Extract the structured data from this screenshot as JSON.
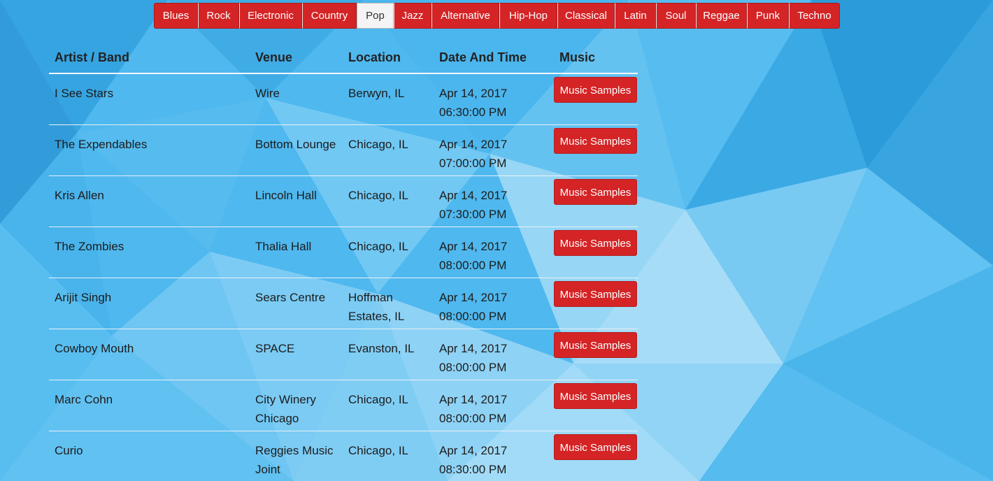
{
  "colors": {
    "accent_red": "#d42426",
    "background_blue": "#4fb8ee",
    "active_tab_bg": "#f4f4f4"
  },
  "genres": [
    {
      "label": "Blues",
      "active": false
    },
    {
      "label": "Rock",
      "active": false
    },
    {
      "label": "Electronic",
      "active": false
    },
    {
      "label": "Country",
      "active": false
    },
    {
      "label": "Pop",
      "active": true
    },
    {
      "label": "Jazz",
      "active": false
    },
    {
      "label": "Alternative",
      "active": false
    },
    {
      "label": "Hip-Hop",
      "active": false
    },
    {
      "label": "Classical",
      "active": false
    },
    {
      "label": "Latin",
      "active": false
    },
    {
      "label": "Soul",
      "active": false
    },
    {
      "label": "Reggae",
      "active": false
    },
    {
      "label": "Punk",
      "active": false
    },
    {
      "label": "Techno",
      "active": false
    }
  ],
  "table": {
    "headers": {
      "artist": "Artist / Band",
      "venue": "Venue",
      "location": "Location",
      "datetime": "Date And Time",
      "music": "Music"
    },
    "button_label": "Music Samples",
    "rows": [
      {
        "artist": "I See Stars",
        "venue": "Wire",
        "location": "Berwyn, IL",
        "date": "Apr 14, 2017",
        "time": "06:30:00 PM"
      },
      {
        "artist": "The Expendables",
        "venue": "Bottom Lounge",
        "location": "Chicago, IL",
        "date": "Apr 14, 2017",
        "time": "07:00:00 PM"
      },
      {
        "artist": "Kris Allen",
        "venue": "Lincoln Hall",
        "location": "Chicago, IL",
        "date": "Apr 14, 2017",
        "time": "07:30:00 PM"
      },
      {
        "artist": "The Zombies",
        "venue": "Thalia Hall",
        "location": "Chicago, IL",
        "date": "Apr 14, 2017",
        "time": "08:00:00 PM"
      },
      {
        "artist": "Arijit Singh",
        "venue": "Sears Centre",
        "location": "Hoffman Estates, IL",
        "date": "Apr 14, 2017",
        "time": "08:00:00 PM"
      },
      {
        "artist": "Cowboy Mouth",
        "venue": "SPACE",
        "location": "Evanston, IL",
        "date": "Apr 14, 2017",
        "time": "08:00:00 PM"
      },
      {
        "artist": "Marc Cohn",
        "venue": "City Winery Chicago",
        "location": "Chicago, IL",
        "date": "Apr 14, 2017",
        "time": "08:00:00 PM"
      },
      {
        "artist": "Curio",
        "venue": "Reggies Music Joint",
        "location": "Chicago, IL",
        "date": "Apr 14, 2017",
        "time": "08:30:00 PM"
      }
    ]
  }
}
